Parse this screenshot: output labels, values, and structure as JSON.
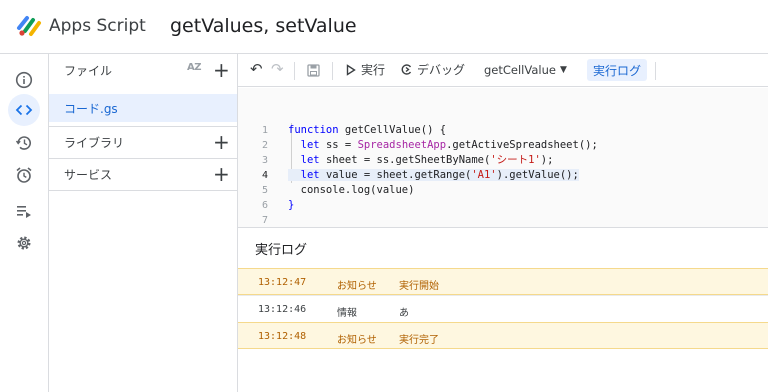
{
  "header": {
    "app_name": "Apps Script",
    "project_title": "getValues, setValue"
  },
  "rail": {
    "items": [
      {
        "icon": "info-icon"
      },
      {
        "icon": "code-icon",
        "active": true
      },
      {
        "icon": "history-icon"
      },
      {
        "icon": "alarm-icon"
      },
      {
        "icon": "executions-icon"
      },
      {
        "icon": "settings-icon"
      }
    ]
  },
  "files_panel": {
    "files_label": "ファイル",
    "sort_label": "AZ",
    "add_label": "+",
    "active_file": "コード.gs",
    "libraries_label": "ライブラリ",
    "services_label": "サービス"
  },
  "toolbar": {
    "undo": "↶",
    "redo": "↷",
    "run_label": "実行",
    "debug_label": "デバッグ",
    "function_select": "getCellValue",
    "execution_log_label": "実行ログ"
  },
  "editor": {
    "line_numbers": [
      "1",
      "2",
      "3",
      "4",
      "5",
      "6",
      "7"
    ],
    "current_line": 4
  },
  "log_panel": {
    "title": "実行ログ",
    "rows": [
      {
        "time": "13:12:47",
        "level": "お知らせ",
        "message": "実行開始",
        "type": "notice"
      },
      {
        "time": "13:12:46",
        "level": "情報",
        "message": "あ",
        "type": "info"
      },
      {
        "time": "13:12:48",
        "level": "お知らせ",
        "message": "実行完了",
        "type": "notice"
      }
    ]
  },
  "colors": {
    "accent": "#1a73e8",
    "active_bg": "#e8f0fe",
    "notice_bg": "#fef7e0",
    "notice_text": "#b06000"
  }
}
